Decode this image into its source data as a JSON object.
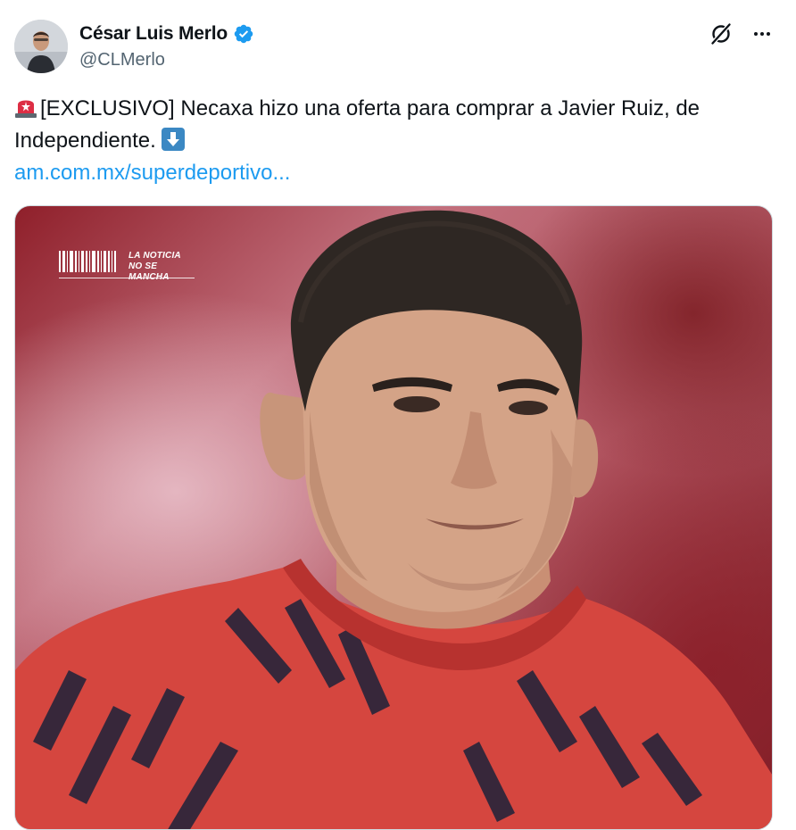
{
  "author": {
    "display_name": "César Luis Merlo",
    "handle": "@CLMerlo",
    "verified": true
  },
  "header": {
    "icons": [
      "grok-icon",
      "more-icon"
    ]
  },
  "tweet": {
    "text_line1": "[EXCLUSIVO] Necaxa hizo una oferta para comprar a Javier Ruiz, de",
    "text_line2": "Independiente.",
    "emojis": [
      "siren-emoji",
      "down-arrow-emoji"
    ],
    "link_text": "am.com.mx/superdeportivo..."
  },
  "media": {
    "watermark_line1": "LA NOTICIA",
    "watermark_line2": "NO SE MANCHA"
  },
  "colors": {
    "link": "#1d9bf0",
    "verified": "#1d9bf0",
    "secondary_text": "#536471",
    "primary_text": "#0f1419"
  }
}
